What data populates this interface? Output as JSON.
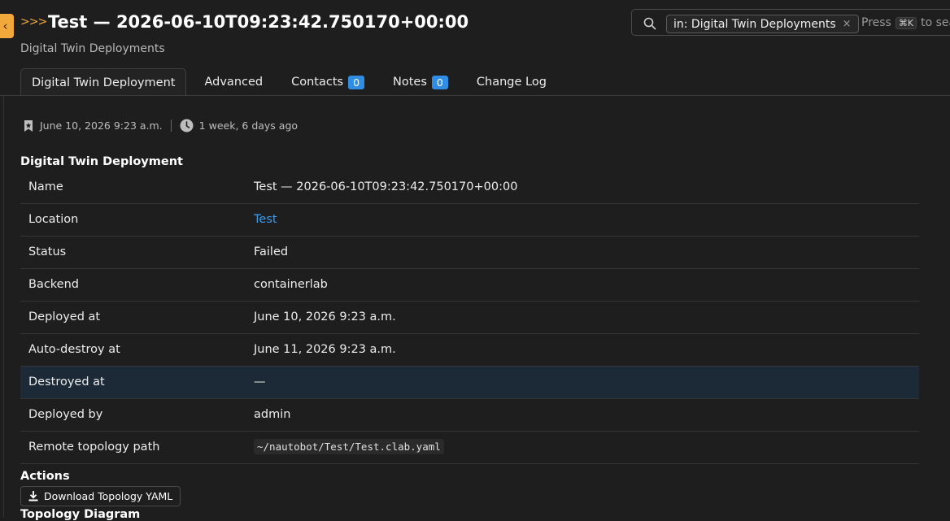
{
  "header": {
    "title": "Test — 2026-06-10T09:23:42.750170+00:00",
    "subtitle": "Digital Twin Deployments",
    "collapse_glyph": "‹",
    "chevrons": ">>>"
  },
  "search": {
    "chip_label": "in: Digital Twin Deployments",
    "chip_close": "×",
    "hint_prefix": "Press",
    "hint_key": "⌘K",
    "hint_suffix": "to search"
  },
  "tabs": [
    {
      "label": "Digital Twin Deployment",
      "active": true
    },
    {
      "label": "Advanced"
    },
    {
      "label": "Contacts",
      "badge": "0"
    },
    {
      "label": "Notes",
      "badge": "0"
    },
    {
      "label": "Change Log"
    }
  ],
  "meta": {
    "created": "June 10, 2026 9:23 a.m.",
    "updated": "1 week, 6 days ago"
  },
  "detail": {
    "heading": "Digital Twin Deployment",
    "rows": [
      {
        "label": "Name",
        "value": "Test — 2026-06-10T09:23:42.750170+00:00"
      },
      {
        "label": "Location",
        "value": "Test"
      },
      {
        "label": "Status",
        "value": "Failed"
      },
      {
        "label": "Backend",
        "value": "containerlab"
      },
      {
        "label": "Deployed at",
        "value": "June 10, 2026 9:23 a.m."
      },
      {
        "label": "Auto-destroy at",
        "value": "June 11, 2026 9:23 a.m."
      },
      {
        "label": "Destroyed at",
        "value": "—"
      },
      {
        "label": "Deployed by",
        "value": "admin"
      },
      {
        "label": "Remote topology path",
        "value": "~/nautobot/Test/Test.clab.yaml"
      }
    ]
  },
  "actions": {
    "heading": "Actions",
    "download_label": "Download Topology YAML"
  },
  "topology": {
    "heading": "Topology Diagram"
  },
  "colors": {
    "accent": "#f0a93a",
    "link": "#3b9cf0",
    "badge": "#2f8ee4",
    "highlight_row": "#1b2a36"
  }
}
